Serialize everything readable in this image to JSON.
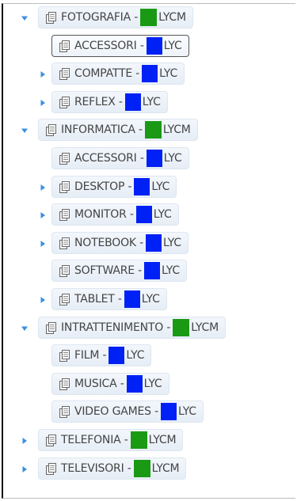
{
  "colors": {
    "green": "#1a9a14",
    "blue": "#0021f5",
    "toggle": "#3a8fe0"
  },
  "tree": [
    {
      "label": "FOTOGRAFIA -",
      "code": "LYCM",
      "swatch": "green",
      "toggle": "expanded",
      "selected": false
    },
    {
      "label": "ACCESSORI -",
      "code": "LYC",
      "swatch": "blue",
      "toggle": "none",
      "selected": true
    },
    {
      "label": "COMPATTE -",
      "code": "LYC",
      "swatch": "blue",
      "toggle": "collapsed",
      "selected": false
    },
    {
      "label": "REFLEX -",
      "code": "LYC",
      "swatch": "blue",
      "toggle": "collapsed",
      "selected": false
    },
    {
      "label": "INFORMATICA -",
      "code": "LYCM",
      "swatch": "green",
      "toggle": "expanded",
      "selected": false
    },
    {
      "label": "ACCESSORI -",
      "code": "LYC",
      "swatch": "blue",
      "toggle": "none",
      "selected": false
    },
    {
      "label": "DESKTOP -",
      "code": "LYC",
      "swatch": "blue",
      "toggle": "collapsed",
      "selected": false
    },
    {
      "label": "MONITOR -",
      "code": "LYC",
      "swatch": "blue",
      "toggle": "collapsed",
      "selected": false
    },
    {
      "label": "NOTEBOOK -",
      "code": "LYC",
      "swatch": "blue",
      "toggle": "collapsed",
      "selected": false
    },
    {
      "label": "SOFTWARE -",
      "code": "LYC",
      "swatch": "blue",
      "toggle": "none",
      "selected": false
    },
    {
      "label": "TABLET -",
      "code": "LYC",
      "swatch": "blue",
      "toggle": "collapsed",
      "selected": false
    },
    {
      "label": "INTRATTENIMENTO -",
      "code": "LYCM",
      "swatch": "green",
      "toggle": "expanded",
      "selected": false
    },
    {
      "label": "FILM -",
      "code": "LYC",
      "swatch": "blue",
      "toggle": "none",
      "selected": false
    },
    {
      "label": "MUSICA -",
      "code": "LYC",
      "swatch": "blue",
      "toggle": "none",
      "selected": false
    },
    {
      "label": "VIDEO GAMES -",
      "code": "LYC",
      "swatch": "blue",
      "toggle": "none",
      "selected": false
    },
    {
      "label": "TELEFONIA -",
      "code": "LYCM",
      "swatch": "green",
      "toggle": "collapsed",
      "selected": false
    },
    {
      "label": "TELEVISORI -",
      "code": "LYCM",
      "swatch": "green",
      "toggle": "collapsed",
      "selected": false
    }
  ]
}
